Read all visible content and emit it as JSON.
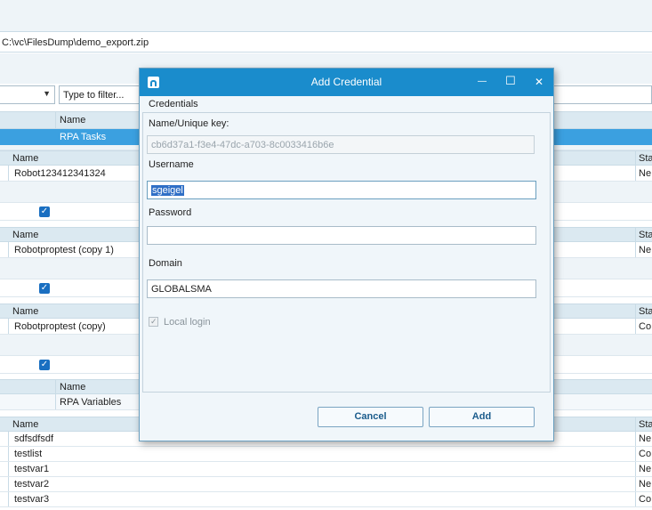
{
  "path_field": {
    "value": "C:\\vc\\FilesDump\\demo_export.zip"
  },
  "filter": {
    "placeholder": "Type to filter..."
  },
  "background": {
    "name_header": "Name",
    "status_header": "Sta",
    "rpa_tasks": "RPA Tasks",
    "rpa_variables": "RPA Variables",
    "robot_rows": [
      {
        "name": "Robot123412341324",
        "status": "Ne"
      },
      {
        "name": "Robotproptest (copy 1)",
        "status": "Ne"
      },
      {
        "name": "Robotproptest (copy)",
        "status": "Co"
      }
    ],
    "variable_rows": [
      {
        "name": "sdfsdfsdf",
        "status": "Ne"
      },
      {
        "name": "testlist",
        "status": "Co"
      },
      {
        "name": "testvar1",
        "status": "Ne"
      },
      {
        "name": "testvar2",
        "status": "Ne"
      },
      {
        "name": "testvar3",
        "status": "Co"
      }
    ],
    "checkmark": "✓"
  },
  "dialog": {
    "title": "Add Credential",
    "minimize": "—",
    "maximize": "☐",
    "close": "✕",
    "section_title": "Credentials",
    "name_key_label": "Name/Unique key:",
    "name_key_value": "cb6d37a1-f3e4-47dc-a703-8c0033416b6e",
    "username_label": "Username",
    "username_value": "sgeigel",
    "password_label": "Password",
    "password_value": "",
    "domain_label": "Domain",
    "domain_value": "GLOBALSMA",
    "local_login_label": "Local login",
    "cancel_label": "Cancel",
    "add_label": "Add"
  },
  "colors": {
    "accent": "#1a8ccc",
    "selected_row": "#3ba0e0",
    "header": "#dbe9f1"
  }
}
